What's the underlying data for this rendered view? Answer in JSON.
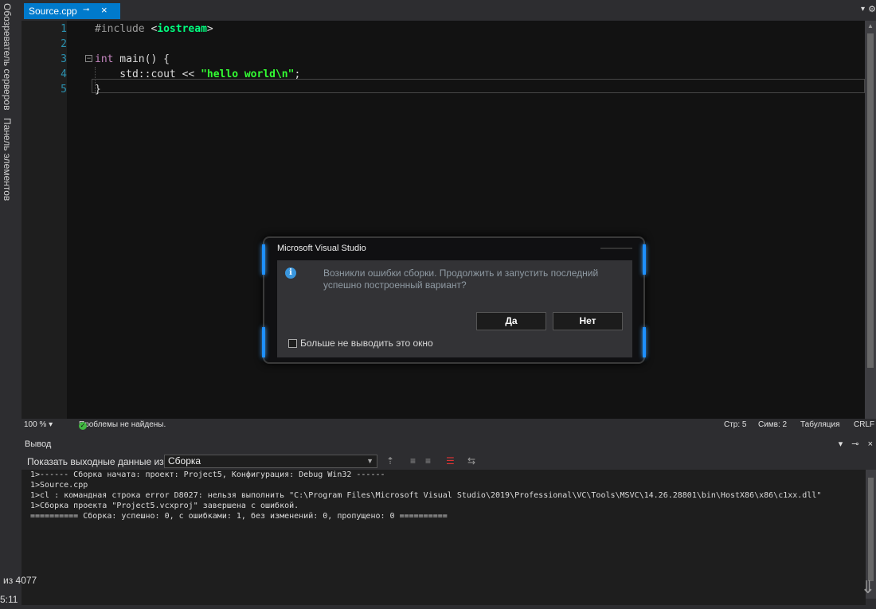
{
  "left_strip": {
    "tab1": "Обозреватель серверов",
    "tab2": "Панель элементов"
  },
  "tabs": [
    {
      "label": "Source.cpp",
      "pin": "⊸",
      "close": "×"
    }
  ],
  "tabbar": {
    "overflow": "▾",
    "settings": "⚙"
  },
  "editor": {
    "lines": [
      {
        "n": "1",
        "parts": [
          {
            "c": "kw-pre",
            "t": "#include "
          },
          {
            "c": "plain",
            "t": "<"
          },
          {
            "c": "inc",
            "t": "iostream"
          },
          {
            "c": "plain",
            "t": ">"
          }
        ]
      },
      {
        "n": "2",
        "parts": []
      },
      {
        "n": "3",
        "parts": [
          {
            "c": "kw-int",
            "t": "int"
          },
          {
            "c": "plain",
            "t": " main() {"
          }
        ]
      },
      {
        "n": "4",
        "parts": [
          {
            "c": "plain",
            "t": "    std::cout << "
          },
          {
            "c": "str-green",
            "t": "\"hello world"
          },
          {
            "c": "str-green",
            "t": "\\n"
          },
          {
            "c": "str-green",
            "t": "\""
          },
          {
            "c": "plain",
            "t": ";"
          }
        ]
      },
      {
        "n": "5",
        "parts": [
          {
            "c": "plain",
            "t": "}"
          }
        ]
      }
    ]
  },
  "status": {
    "zoom": "100 %",
    "zoom_chev": "▾",
    "problems": "Проблемы не найдены.",
    "line": "Стр: 5",
    "col": "Симв: 2",
    "tabs": "Табуляция",
    "eol": "CRLF"
  },
  "output": {
    "title": "Вывод",
    "title_controls": [
      "▾",
      "⊸",
      "×"
    ],
    "show_from_label": "Показать выходные данные из:",
    "show_from_value": "Сборка",
    "lines": [
      "1>------ Сборка начата: проект: Project5, Конфигурация: Debug Win32 ------",
      "1>Source.cpp",
      "1>cl : командная строка error D8027: нельзя выполнить \"C:\\Program Files\\Microsoft Visual Studio\\2019\\Professional\\VC\\Tools\\MSVC\\14.26.28801\\bin\\HostX86\\x86\\c1xx.dll\"",
      "1>Сборка проекта \"Project5.vcxproj\" завершена с ошибкой.",
      "========== Сборка: успешно: 0, с ошибками: 1, без изменений: 0, пропущено: 0 =========="
    ]
  },
  "corner": {
    "page_count": "из 4077",
    "time": "5:11"
  },
  "dialog": {
    "title": "Microsoft Visual Studio",
    "message": "Возникли ошибки сборки. Продолжить и запустить последний успешно построенный вариант?",
    "yes": "Да",
    "no": "Нет",
    "checkbox_label": "Больше не выводить это окно"
  }
}
